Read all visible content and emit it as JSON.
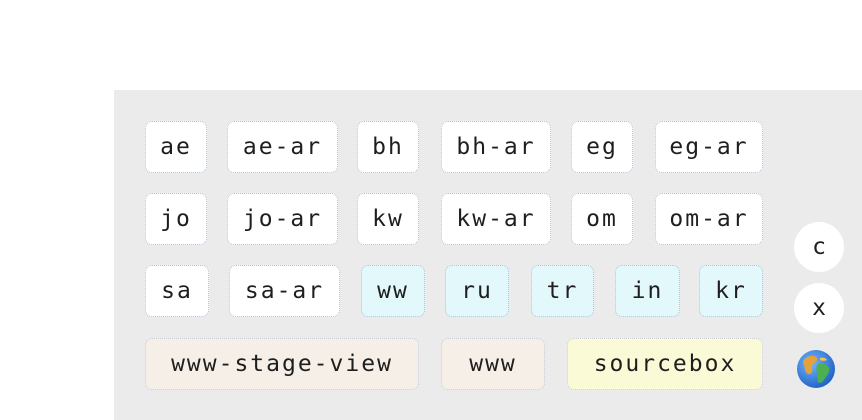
{
  "rows": [
    [
      "ae",
      "ae-ar",
      "bh",
      "bh-ar",
      "eg",
      "eg-ar"
    ],
    [
      "jo",
      "jo-ar",
      "kw",
      "kw-ar",
      "om",
      "om-ar"
    ],
    [
      "sa",
      "sa-ar",
      "ww",
      "ru",
      "tr",
      "in",
      "kr"
    ],
    [
      "www-stage-view",
      "www",
      "sourcebox"
    ]
  ],
  "side_buttons": {
    "c_label": "c",
    "x_label": "x",
    "globe_icon": "globe-icon"
  },
  "colors": {
    "panel_bg": "#ebebeb",
    "chip_bg": "#ffffff",
    "chip_cyan_bg": "#e3f8fb",
    "chip_peach_bg": "#f6efe7",
    "chip_yellow_bg": "#fbfad7",
    "chip_border": "#a9c2e0"
  }
}
